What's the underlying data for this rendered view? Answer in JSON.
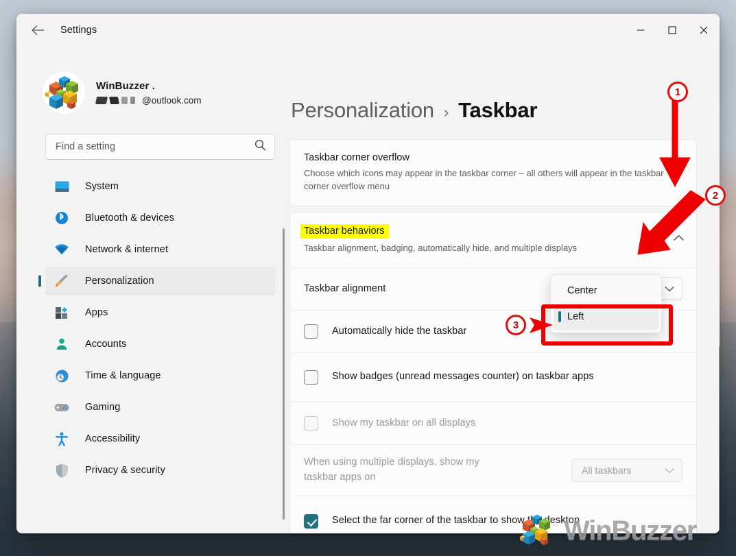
{
  "window": {
    "title": "Settings",
    "back_icon": "back-arrow-icon",
    "minimize": "—",
    "maximize": "☐",
    "close": "✕"
  },
  "account": {
    "name": "WinBuzzer .",
    "email_suffix": "@outlook.com"
  },
  "search": {
    "placeholder": "Find a setting",
    "icon": "search-icon"
  },
  "sidebar": {
    "items": [
      {
        "label": "System",
        "icon": "monitor-icon",
        "active": false
      },
      {
        "label": "Bluetooth & devices",
        "icon": "bluetooth-icon",
        "active": false
      },
      {
        "label": "Network & internet",
        "icon": "wifi-icon",
        "active": false
      },
      {
        "label": "Personalization",
        "icon": "paintbrush-icon",
        "active": true
      },
      {
        "label": "Apps",
        "icon": "apps-grid-icon",
        "active": false
      },
      {
        "label": "Accounts",
        "icon": "person-icon",
        "active": false
      },
      {
        "label": "Time & language",
        "icon": "clock-globe-icon",
        "active": false
      },
      {
        "label": "Gaming",
        "icon": "gamepad-icon",
        "active": false
      },
      {
        "label": "Accessibility",
        "icon": "accessibility-person-icon",
        "active": false
      },
      {
        "label": "Privacy & security",
        "icon": "shield-icon",
        "active": false
      }
    ]
  },
  "breadcrumb": {
    "parent": "Personalization",
    "separator": "›",
    "current": "Taskbar"
  },
  "cards": {
    "corner_overflow": {
      "title": "Taskbar corner overflow",
      "subtitle": "Choose which icons may appear in the taskbar corner – all others will appear in the taskbar corner overflow menu"
    },
    "behaviors": {
      "title": "Taskbar behaviors",
      "subtitle": "Taskbar alignment, badging, automatically hide, and multiple displays",
      "collapse_icon": "chevron-up-icon",
      "highlighted": true,
      "rows": {
        "alignment": {
          "label": "Taskbar alignment",
          "value": "Left",
          "chevron": "chevron-down-icon",
          "options": [
            "Center",
            "Left"
          ],
          "selected_option": "Left"
        },
        "auto_hide": {
          "label": "Automatically hide the taskbar",
          "checked": false,
          "disabled": false
        },
        "badges": {
          "label": "Show badges (unread messages counter) on taskbar apps",
          "checked": false,
          "disabled": false
        },
        "all_displays": {
          "label": "Show my taskbar on all displays",
          "checked": false,
          "disabled": true
        },
        "multi_display": {
          "label": "When using multiple displays, show my taskbar apps on",
          "value": "All taskbars",
          "chevron": "chevron-down-icon",
          "disabled": true
        },
        "far_corner": {
          "label": "Select the far corner of the taskbar to show the desktop",
          "checked": true,
          "disabled": false
        }
      }
    }
  },
  "annotations": {
    "markers": [
      {
        "number": "1",
        "arrow": "down-arrow"
      },
      {
        "number": "2",
        "arrow": "diagonal-down-left-arrow"
      },
      {
        "number": "3",
        "arrow": "right-arrow"
      }
    ],
    "highlight_color": "#ffff00",
    "marker_color": "#ee0000"
  },
  "watermark": {
    "text": "WinBuzzer"
  }
}
